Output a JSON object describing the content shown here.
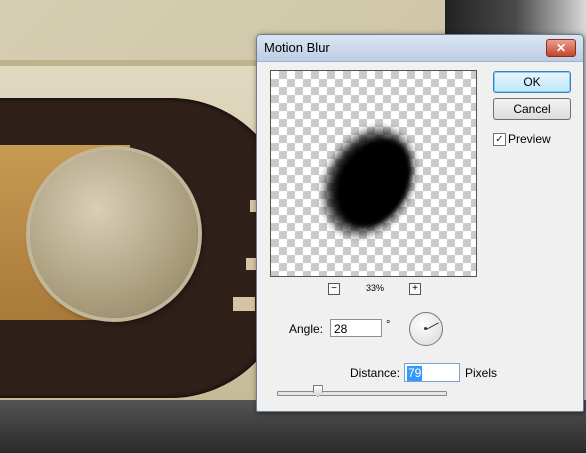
{
  "dialog": {
    "title": "Motion Blur",
    "close_label": "✕",
    "ok_label": "OK",
    "cancel_label": "Cancel",
    "preview_label": "Preview",
    "preview_checked": true,
    "zoom": {
      "minus_label": "−",
      "plus_label": "+",
      "level": "33%"
    },
    "angle": {
      "label": "Angle:",
      "value": "28",
      "unit": "°"
    },
    "distance": {
      "label": "Distance:",
      "value": "79",
      "unit": "Pixels",
      "slider_fraction": 0.24
    }
  },
  "colors": {
    "title_bar": "#bccde3",
    "close_button": "#c4442d",
    "selection": "#3399ff"
  },
  "icons": [
    "close-icon",
    "zoom-out-icon",
    "zoom-in-icon",
    "checkmark-icon",
    "angle-dial-icon"
  ]
}
